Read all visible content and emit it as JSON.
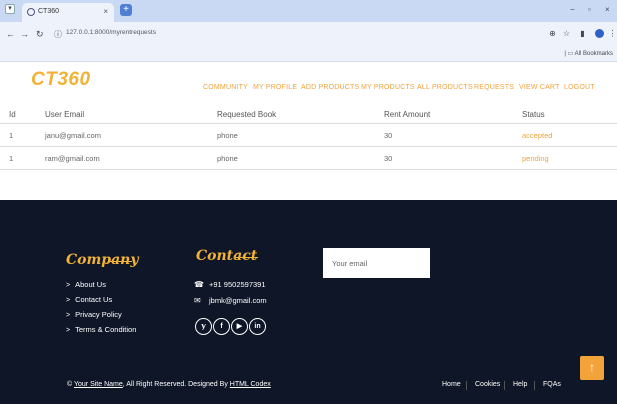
{
  "browser": {
    "tab_title": "CT360",
    "tab_close": "×",
    "new_tab": "+",
    "url": "127.0.0.1:8000/myrentrequests",
    "bookmarks_label": "All Bookmarks",
    "win_minimize": "−",
    "win_maximize": "▫",
    "win_close": "×"
  },
  "site": {
    "logo": "CT360",
    "nav": [
      "COMMUNITY",
      "MY PROFILE",
      "ADD PRODUCTS",
      "MY PRODUCTS",
      "ALL PRODUCTS",
      "REQUESTS",
      "VIEW CART",
      "LOGOUT"
    ]
  },
  "table": {
    "headers": [
      "Id",
      "User Email",
      "Requested Book",
      "Rent Amount",
      "Status"
    ],
    "rows": [
      [
        "1",
        "janu@gmail.com",
        "phone",
        "30",
        "accepted"
      ],
      [
        "1",
        "ram@gmail.com",
        "phone",
        "30",
        "pending"
      ]
    ]
  },
  "footer": {
    "company_heading": "Company",
    "contact_heading": "Contact",
    "company_links": [
      "About Us",
      "Contact Us",
      "Privacy Policy",
      "Terms & Condition"
    ],
    "phone": "+91 9502597391",
    "email": "jbmk@gmail.com",
    "social": [
      "twitter-icon",
      "facebook-icon",
      "youtube-icon",
      "linkedin-icon"
    ],
    "social_glyphs": [
      "𝕪",
      "f",
      "▶",
      "in"
    ],
    "email_placeholder": "Your email",
    "copyright_prefix": "© ",
    "copyright_site": "Your Site Name",
    "copyright_mid": ", All Right Reserved. Designed By ",
    "copyright_designer": "HTML Codex",
    "bottom_nav": [
      "Home",
      "Cookies",
      "Help",
      "FQAs"
    ],
    "back_to_top": "↑"
  },
  "colors": {
    "accent": "#f2b235",
    "footer_bg": "#0f1627",
    "browser_chrome": "#c9d9f3"
  }
}
